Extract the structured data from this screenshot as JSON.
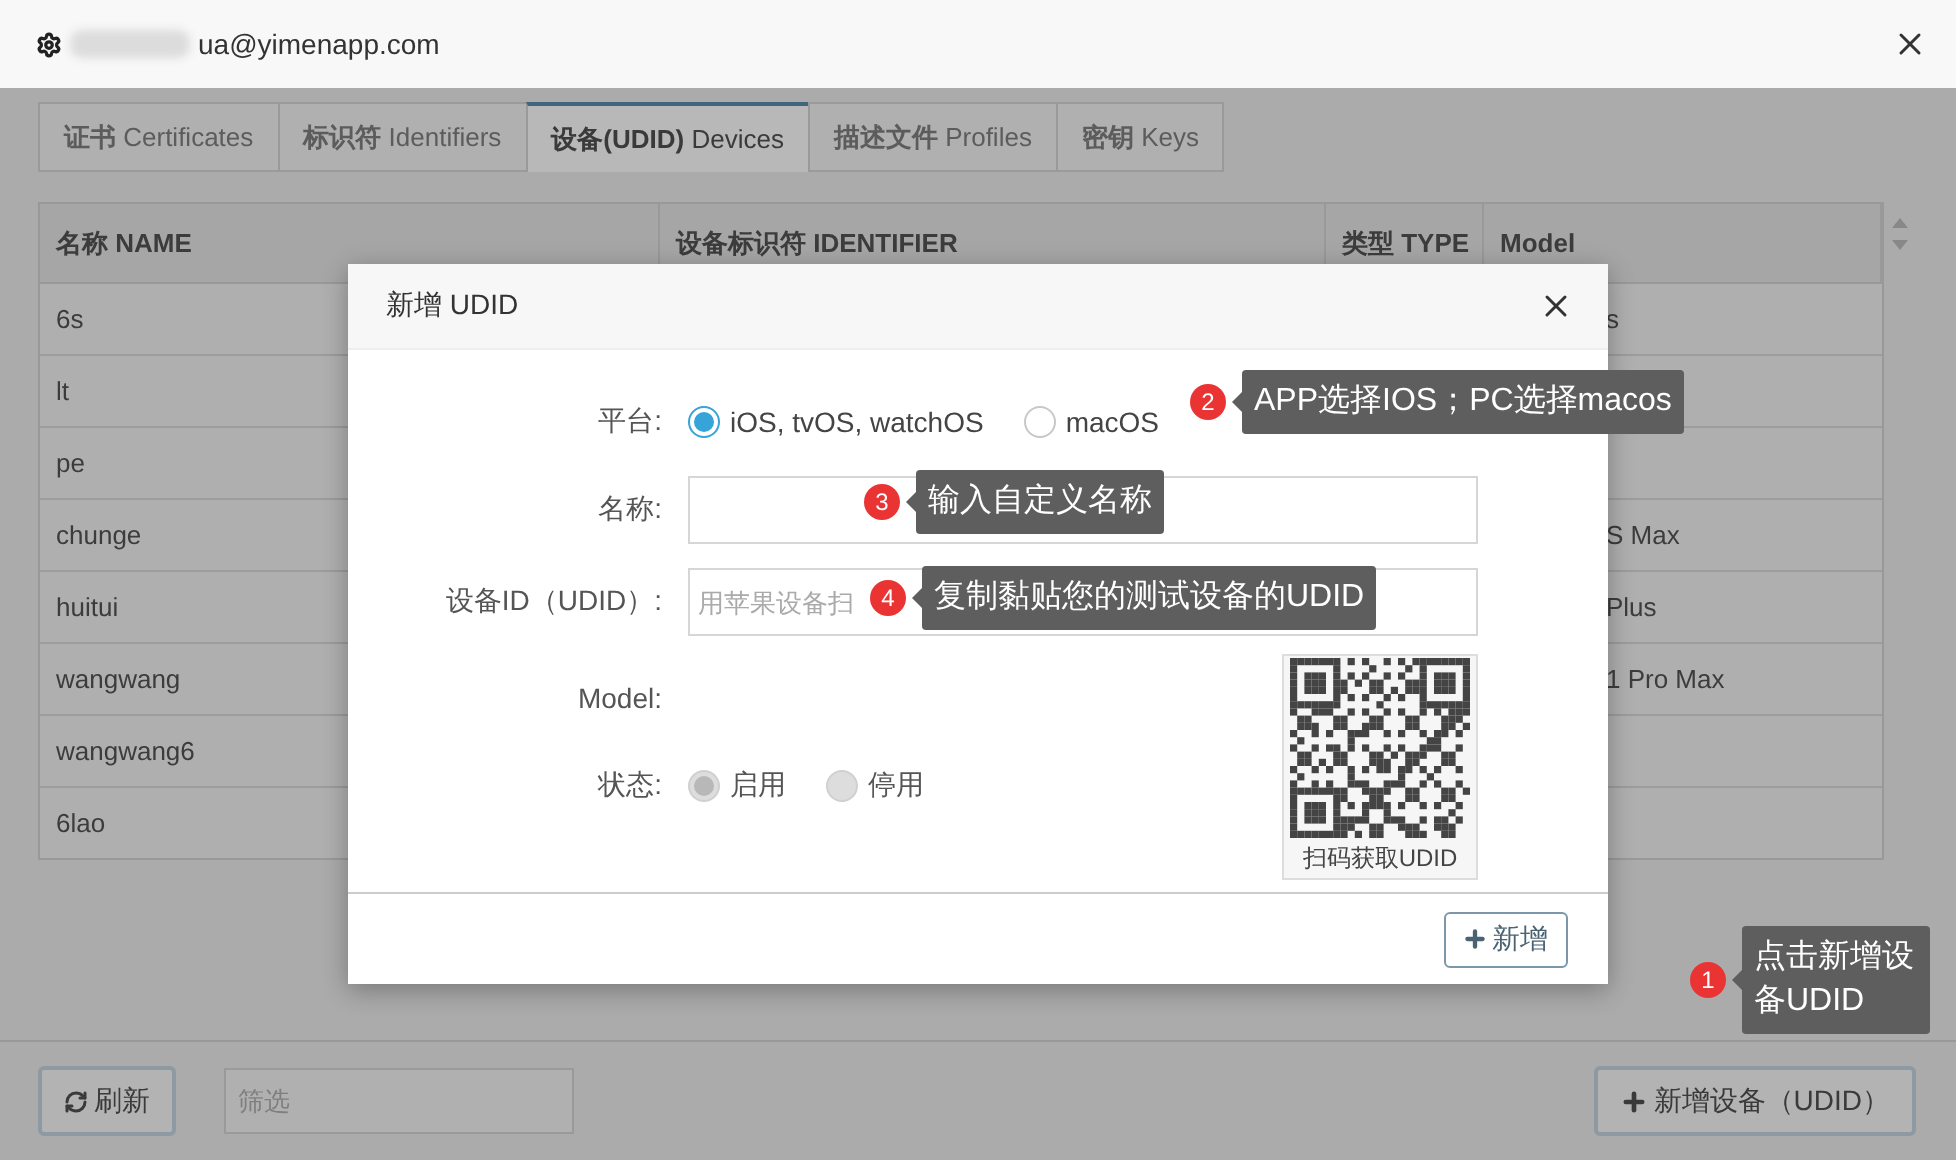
{
  "header": {
    "title": "ua@yimenapp.com"
  },
  "tabs": [
    {
      "name": "证书",
      "en": "Certificates",
      "selected": false
    },
    {
      "name": "标识符",
      "en": "Identifiers",
      "selected": false
    },
    {
      "name": "设备(UDID)",
      "en": "Devices",
      "selected": true
    },
    {
      "name": "描述文件",
      "en": "Profiles",
      "selected": false
    },
    {
      "name": "密钥",
      "en": "Keys",
      "selected": false
    }
  ],
  "table": {
    "columns": [
      "名称 NAME",
      "设备标识符 IDENTIFIER",
      "类型 TYPE",
      "Model"
    ],
    "rows": [
      {
        "name": "6s",
        "model": "s"
      },
      {
        "name": "lt"
      },
      {
        "name": "pe"
      },
      {
        "name": "chunge",
        "model": "S Max"
      },
      {
        "name": "huitui",
        "model": "Plus"
      },
      {
        "name": "wangwang",
        "model": "1 Pro Max"
      },
      {
        "name": "wangwang6"
      },
      {
        "name": "6lao"
      }
    ]
  },
  "toolbar": {
    "refresh": "刷新",
    "filter_placeholder": "筛选",
    "add": "新增设备（UDID）"
  },
  "modal": {
    "title": "新增 UDID",
    "fields": [
      {
        "kind": "radio",
        "label": "平台:",
        "disabled": false,
        "options": [
          {
            "label": "iOS, tvOS, watchOS",
            "selected": true
          },
          {
            "label": "macOS",
            "selected": false
          }
        ]
      },
      {
        "kind": "input",
        "label": "名称:"
      },
      {
        "kind": "input",
        "label": "设备ID（UDID）:",
        "placeholder": "用苹果设备扫"
      },
      {
        "kind": "text",
        "label": "Model:"
      },
      {
        "kind": "radio",
        "label": "状态:",
        "disabled": true,
        "options": [
          {
            "label": "启用",
            "selected": true
          },
          {
            "label": "停用",
            "selected": false
          }
        ]
      }
    ],
    "qr_caption": "扫码获取UDID",
    "submit": "新增"
  },
  "callouts": [
    {
      "number": "1",
      "text": "点击新增设备UDID"
    },
    {
      "number": "2",
      "text": "APP选择IOS；PC选择macos"
    },
    {
      "number": "3",
      "text": "输入自定义名称"
    },
    {
      "number": "4",
      "text": "复制黏贴您的测试设备的UDID"
    }
  ]
}
